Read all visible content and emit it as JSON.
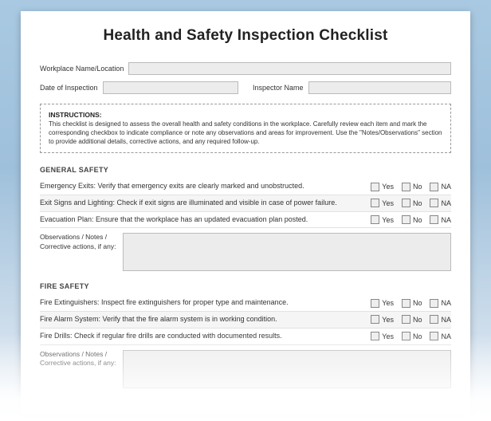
{
  "title": "Health and Safety Inspection Checklist",
  "fields": {
    "workplace_label": "Workplace Name/Location",
    "workplace_value": "",
    "date_label": "Date of Inspection",
    "date_value": "",
    "inspector_label": "Inspector Name",
    "inspector_value": ""
  },
  "instructions": {
    "heading": "INSTRUCTIONS:",
    "body": "This checklist is designed to assess the overall health and safety conditions in the workplace. Carefully review each item and mark the corresponding checkbox to indicate compliance or note any observations and areas for improvement. Use the \"Notes/Observations\" section to provide additional details, corrective actions, and any required follow-up."
  },
  "option_labels": {
    "yes": "Yes",
    "no": "No",
    "na": "NA"
  },
  "notes_label": "Observations / Notes / Corrective actions, if any:",
  "sections": [
    {
      "title": "GENERAL SAFETY",
      "items": [
        "Emergency Exits: Verify that emergency exits are clearly marked and unobstructed.",
        "Exit Signs and Lighting: Check if exit signs are illuminated and visible in case of power failure.",
        "Evacuation Plan: Ensure that the workplace has an updated evacuation plan posted."
      ]
    },
    {
      "title": "FIRE SAFETY",
      "items": [
        "Fire Extinguishers: Inspect fire extinguishers for proper type and maintenance.",
        "Fire Alarm System: Verify that the fire alarm system is in working condition.",
        "Fire Drills: Check if regular fire drills are conducted with documented results."
      ]
    }
  ]
}
